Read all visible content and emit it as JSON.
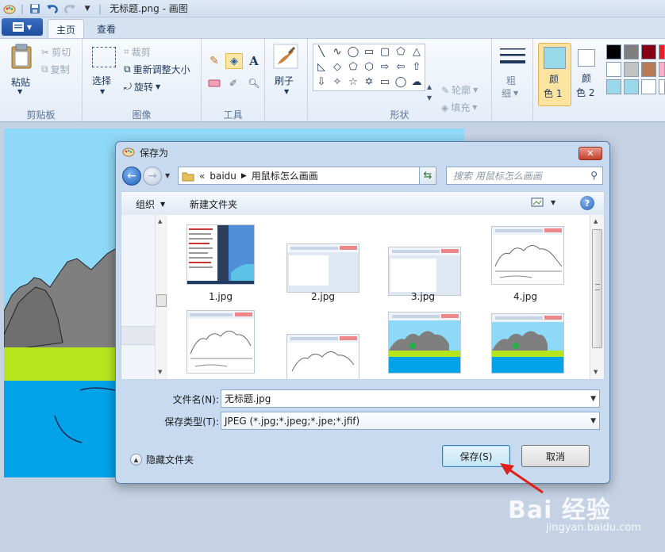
{
  "window": {
    "title": "无标题.png - 画图"
  },
  "tabs": {
    "home": "主页",
    "view": "查看"
  },
  "ribbon": {
    "clipboard": {
      "paste": "粘贴",
      "cut": "剪切",
      "copy": "复制",
      "label": "剪贴板"
    },
    "image": {
      "select": "选择",
      "crop": "裁剪",
      "resize": "重新调整大小",
      "rotate": "旋转",
      "label": "图像"
    },
    "tools": {
      "label": "工具"
    },
    "brushes": {
      "label": "刷子"
    },
    "shapes": {
      "outline": "轮廓",
      "fill": "填充",
      "label": "形状"
    },
    "size": {
      "label_line1": "粗",
      "label_line2": "细"
    },
    "color1": {
      "line1": "颜",
      "line2": "色 1"
    },
    "color2": {
      "line1": "颜",
      "line2": "色 2"
    },
    "palette": [
      "#000000",
      "#7f7f7f",
      "#880015",
      "#ed1c24",
      "#ffffff",
      "#c3c3c3",
      "#b97a57",
      "#ffaec9",
      "#99d9ea",
      "#99d9ea",
      "#ffffff",
      "#ffffff"
    ],
    "color1_value": "#99d9ea",
    "color2_value": "#ffffff"
  },
  "dialog": {
    "title": "保存为",
    "path": {
      "root": "baidu",
      "current": "用鼠标怎么画画"
    },
    "search_placeholder": "搜索 用鼠标怎么画画",
    "toolbar": {
      "organize": "组织",
      "new_folder": "新建文件夹"
    },
    "files": [
      "1.jpg",
      "2.jpg",
      "3.jpg",
      "4.jpg"
    ],
    "filename_label": "文件名(N):",
    "filename_value": "无标题.jpg",
    "filetype_label": "保存类型(T):",
    "filetype_value": "JPEG (*.jpg;*.jpeg;*.jpe;*.jfif)",
    "hide_folders": "隐藏文件夹",
    "save_button": "保存(S)",
    "cancel_button": "取消"
  },
  "watermark": {
    "logo": "Bai 经验",
    "url": "jingyan.baidu.com"
  }
}
